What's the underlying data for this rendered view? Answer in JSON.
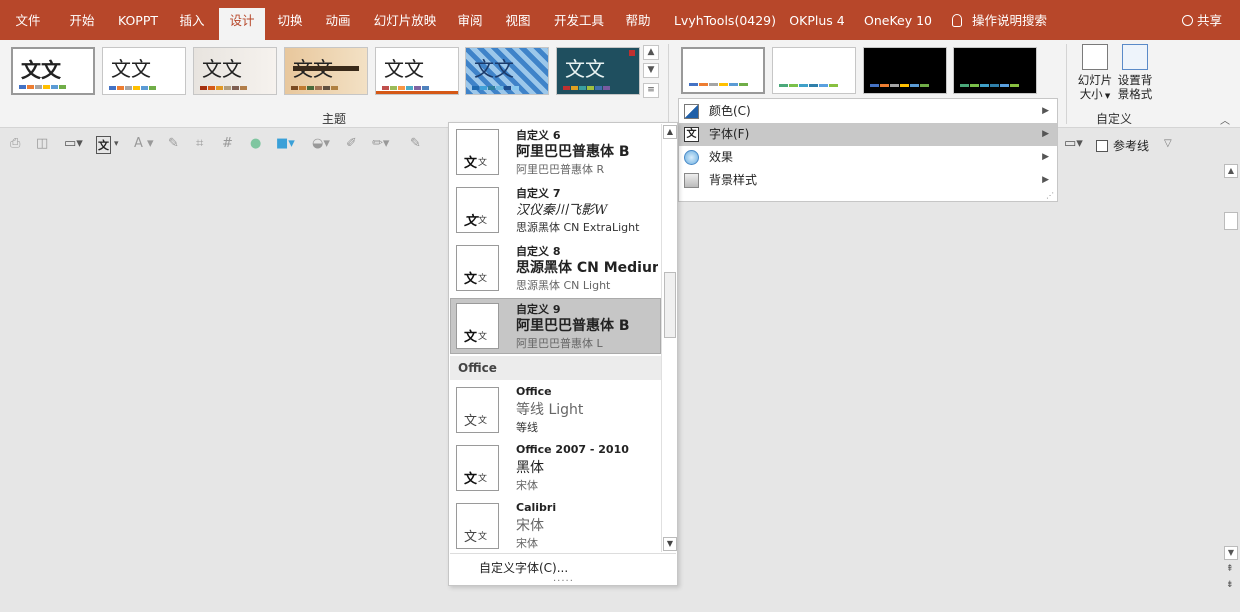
{
  "menubar": {
    "tabs": [
      "文件",
      "开始",
      "KOPPT",
      "插入",
      "设计",
      "切换",
      "动画",
      "幻灯片放映",
      "审阅",
      "视图",
      "开发工具",
      "帮助",
      "LvyhTools(0429)",
      "OKPlus 4",
      "OneKey 10"
    ],
    "active_tab": "设计",
    "search_label": "操作说明搜索",
    "share_label": "共享"
  },
  "ribbon": {
    "themes_text": [
      "文文",
      "文文",
      "文文",
      "文文",
      "文文",
      "文文",
      "文文"
    ],
    "themes_group_label": "主题",
    "custom_group_label": "自定义",
    "slide_size_label_1": "幻灯片",
    "slide_size_label_2": "大小",
    "bg_format_label_1": "设置背",
    "bg_format_label_2": "景格式",
    "theme_glyph": "文"
  },
  "toolbar": {
    "guides_label": "参考线"
  },
  "variants_menu": {
    "items": [
      {
        "label": "颜色(C)",
        "icon": "colors-icon"
      },
      {
        "label": "字体(F)",
        "icon": "fonts-icon"
      },
      {
        "label": "效果",
        "icon": "effects-icon"
      },
      {
        "label": "背景样式",
        "icon": "background-styles-icon"
      }
    ],
    "hovered": "字体(F)"
  },
  "fonts_panel": {
    "custom_items": [
      {
        "name": "自定义 6",
        "heading": "阿里巴巴普惠体 B",
        "body": "阿里巴巴普惠体 R"
      },
      {
        "name": "自定义 7",
        "heading": "汉仪秦川飞影W",
        "body": "思源黑体 CN ExtraLight"
      },
      {
        "name": "自定义 8",
        "heading": "思源黑体 CN Medium",
        "body": "思源黑体 CN Light"
      },
      {
        "name": "自定义 9",
        "heading": "阿里巴巴普惠体 B",
        "body": "阿里巴巴普惠体 L"
      }
    ],
    "selected": "自定义 9",
    "office_header": "Office",
    "office_items": [
      {
        "name": "Office",
        "heading": "等线 Light",
        "body": "等线"
      },
      {
        "name": "Office 2007 - 2010",
        "heading": "黑体",
        "body": "宋体"
      },
      {
        "name": "Calibri",
        "heading": "宋体",
        "body": "宋体"
      }
    ],
    "thumb_glyph_a": "文",
    "thumb_glyph_b": "文",
    "custom_fonts_label": "自定义字体(C)...",
    "grip": "....."
  },
  "colors": {
    "accent": "#b7472a",
    "hover": "#c8c8c8"
  }
}
